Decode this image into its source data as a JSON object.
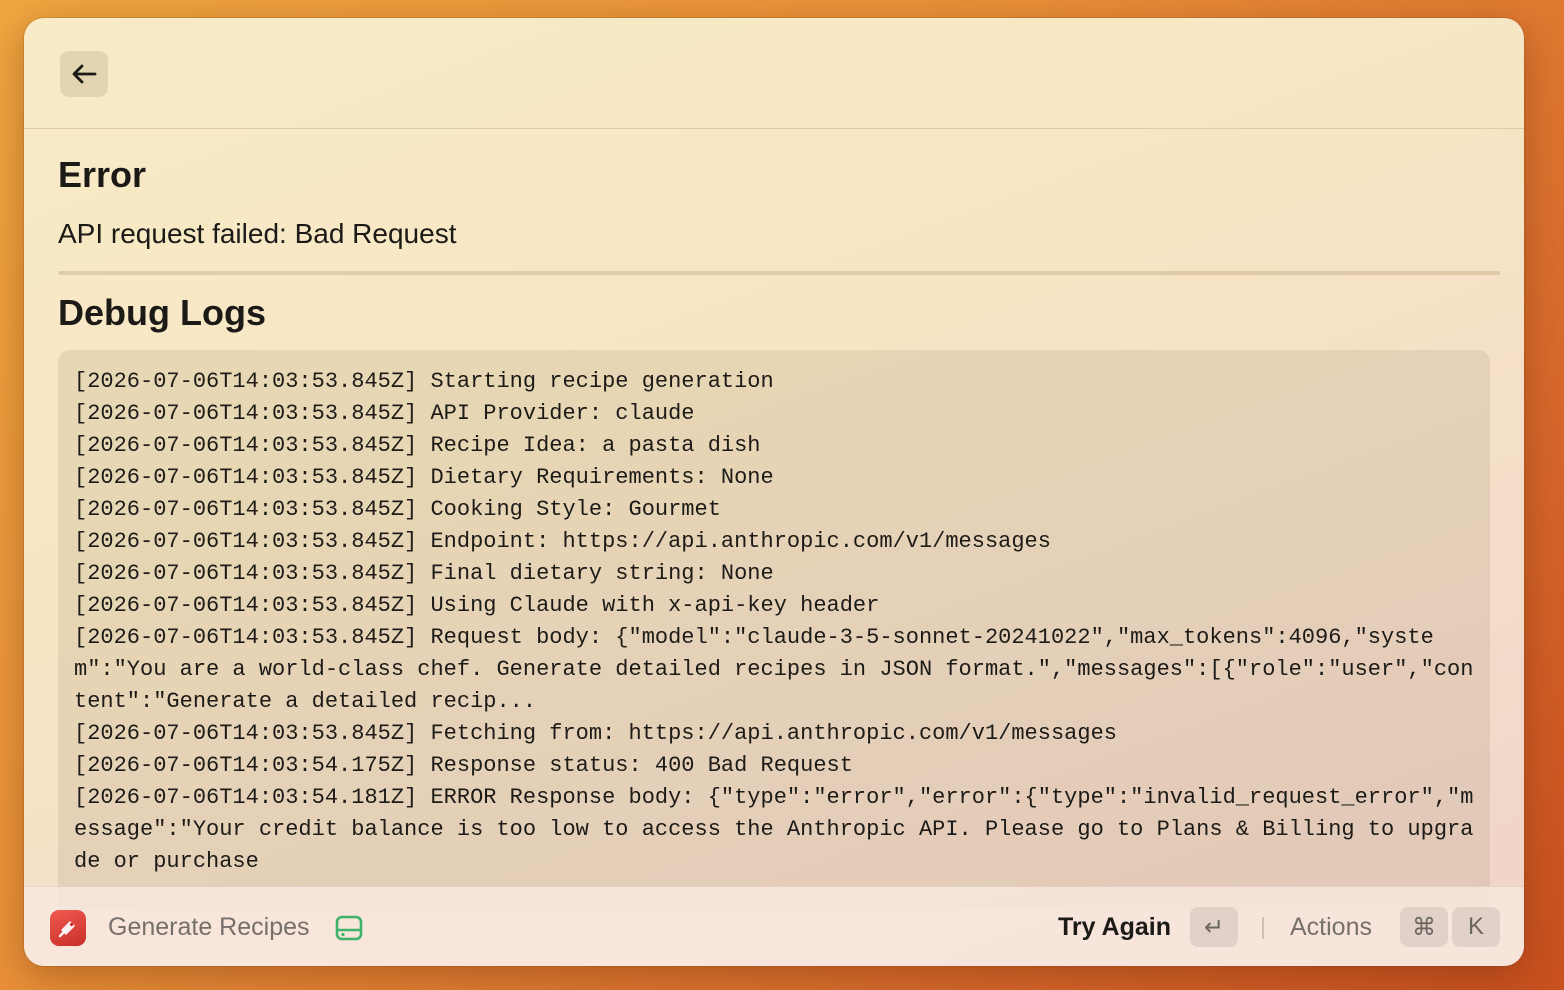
{
  "error": {
    "heading": "Error",
    "message": "API request failed: Bad Request"
  },
  "debug": {
    "heading": "Debug Logs",
    "lines": [
      "[2026-07-06T14:03:53.845Z] Starting recipe generation",
      "[2026-07-06T14:03:53.845Z] API Provider: claude",
      "[2026-07-06T14:03:53.845Z] Recipe Idea: a pasta dish",
      "[2026-07-06T14:03:53.845Z] Dietary Requirements: None",
      "[2026-07-06T14:03:53.845Z] Cooking Style: Gourmet",
      "[2026-07-06T14:03:53.845Z] Endpoint: https://api.anthropic.com/v1/messages",
      "[2026-07-06T14:03:53.845Z] Final dietary string: None",
      "[2026-07-06T14:03:53.845Z] Using Claude with x-api-key header",
      "[2026-07-06T14:03:53.845Z] Request body: {\"model\":\"claude-3-5-sonnet-20241022\",\"max_tokens\":4096,\"system\":\"You are a world-class chef. Generate detailed recipes in JSON format.\",\"messages\":[{\"role\":\"user\",\"content\":\"Generate a detailed recip...",
      "[2026-07-06T14:03:53.845Z] Fetching from: https://api.anthropic.com/v1/messages",
      "[2026-07-06T14:03:54.175Z] Response status: 400 Bad Request",
      "[2026-07-06T14:03:54.181Z] ERROR Response body: {\"type\":\"error\",\"error\":{\"type\":\"invalid_request_error\",\"message\":\"Your credit balance is too low to access the Anthropic API. Please go to Plans & Billing to upgrade or purchase"
    ]
  },
  "footer": {
    "app_name": "Generate Recipes",
    "primary_action": "Try Again",
    "primary_key": "↵",
    "actions_label": "Actions",
    "actions_keys": [
      "⌘",
      "K"
    ]
  },
  "colors": {
    "app_icon": "#e24a42",
    "drive_icon": "#3db36a"
  }
}
